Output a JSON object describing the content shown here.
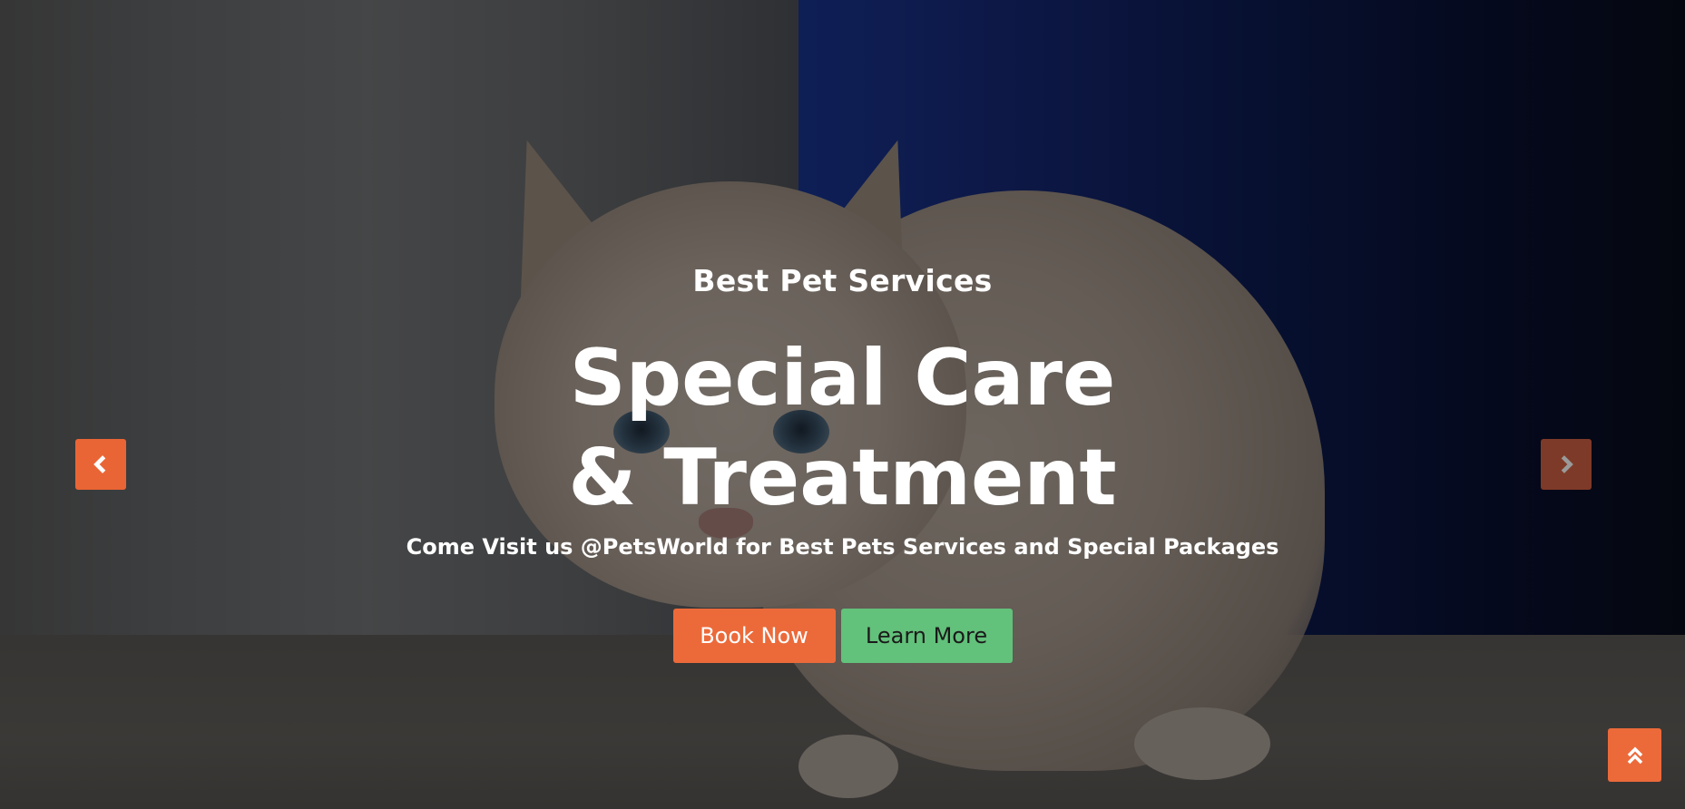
{
  "hero": {
    "subtitle": "Best Pet Services",
    "title": "Special Care & Treatment",
    "description": "Come Visit us @PetsWorld for Best Pets Services and Special Packages",
    "primary_button": "Book Now",
    "secondary_button": "Learn More"
  },
  "controls": {
    "prev_icon": "chevron-left-icon",
    "next_icon": "chevron-right-icon",
    "back_to_top_icon": "double-chevron-up-icon"
  },
  "colors": {
    "primary": "#ec6a3a",
    "secondary": "#62c17a",
    "next_arrow_bg": "#7e3a28",
    "text": "#ffffff"
  }
}
